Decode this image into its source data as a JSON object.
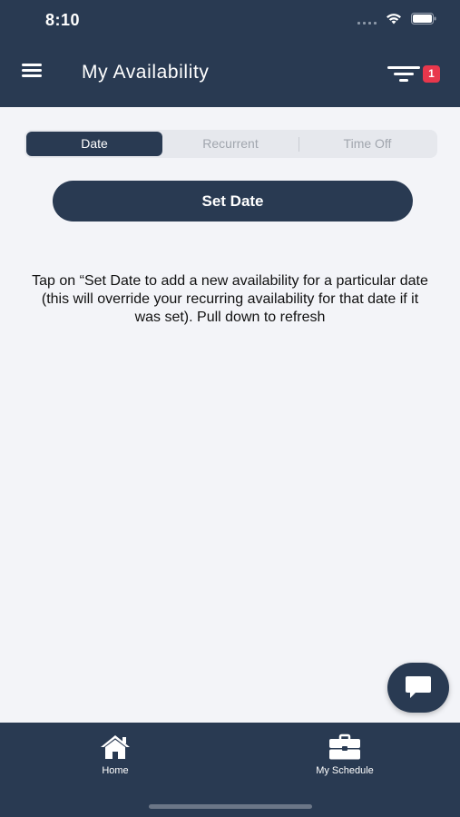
{
  "status_bar": {
    "time": "8:10"
  },
  "header": {
    "title": "My Availability",
    "filter_badge_count": "1"
  },
  "tabs": [
    {
      "label": "Date",
      "active": true
    },
    {
      "label": "Recurrent",
      "active": false
    },
    {
      "label": "Time Off",
      "active": false
    }
  ],
  "set_date_button": {
    "label": "Set Date"
  },
  "hint_text": "Tap on “Set Date to add a new availability for a particular date (this will override your recurring availability for that date if it was set). Pull down to refresh",
  "bottom_nav": [
    {
      "label": "Home",
      "icon": "home-icon"
    },
    {
      "label": "My Schedule",
      "icon": "briefcase-icon"
    }
  ],
  "colors": {
    "primary": "#293a52",
    "background": "#f3f4f8",
    "badge": "#e8374c",
    "segment_bg": "#e6e8ed"
  }
}
